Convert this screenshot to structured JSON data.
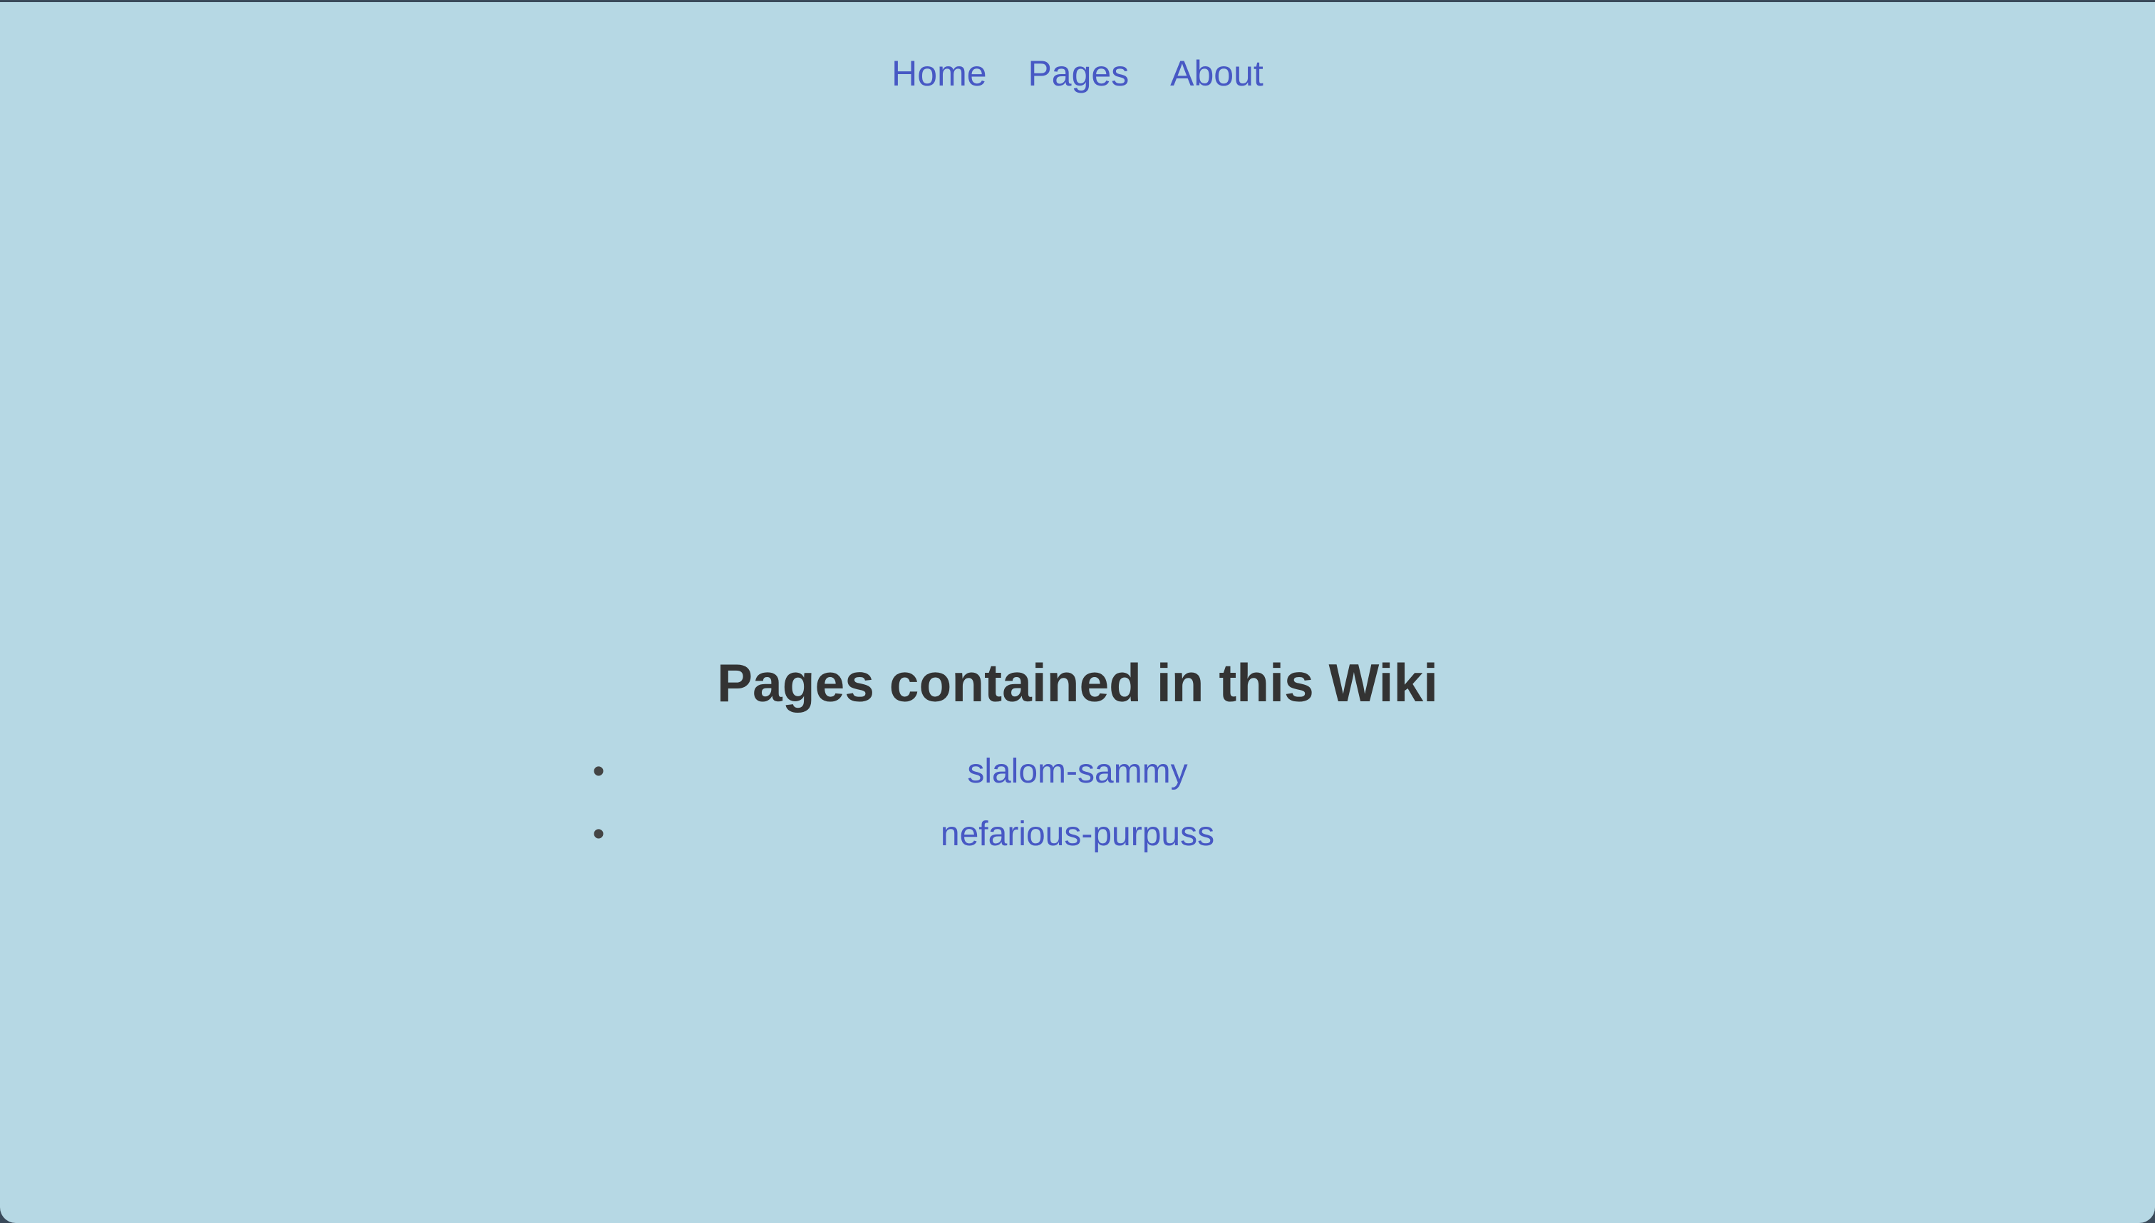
{
  "nav": {
    "items": [
      {
        "label": "Home"
      },
      {
        "label": "Pages"
      },
      {
        "label": "About"
      }
    ]
  },
  "main": {
    "title": "Pages contained in this Wiki",
    "pages": [
      {
        "label": "slalom-sammy"
      },
      {
        "label": "nefarious-purpuss"
      }
    ]
  },
  "colors": {
    "background": "#b6d8e4",
    "link": "#4758c4",
    "heading": "#333333"
  }
}
